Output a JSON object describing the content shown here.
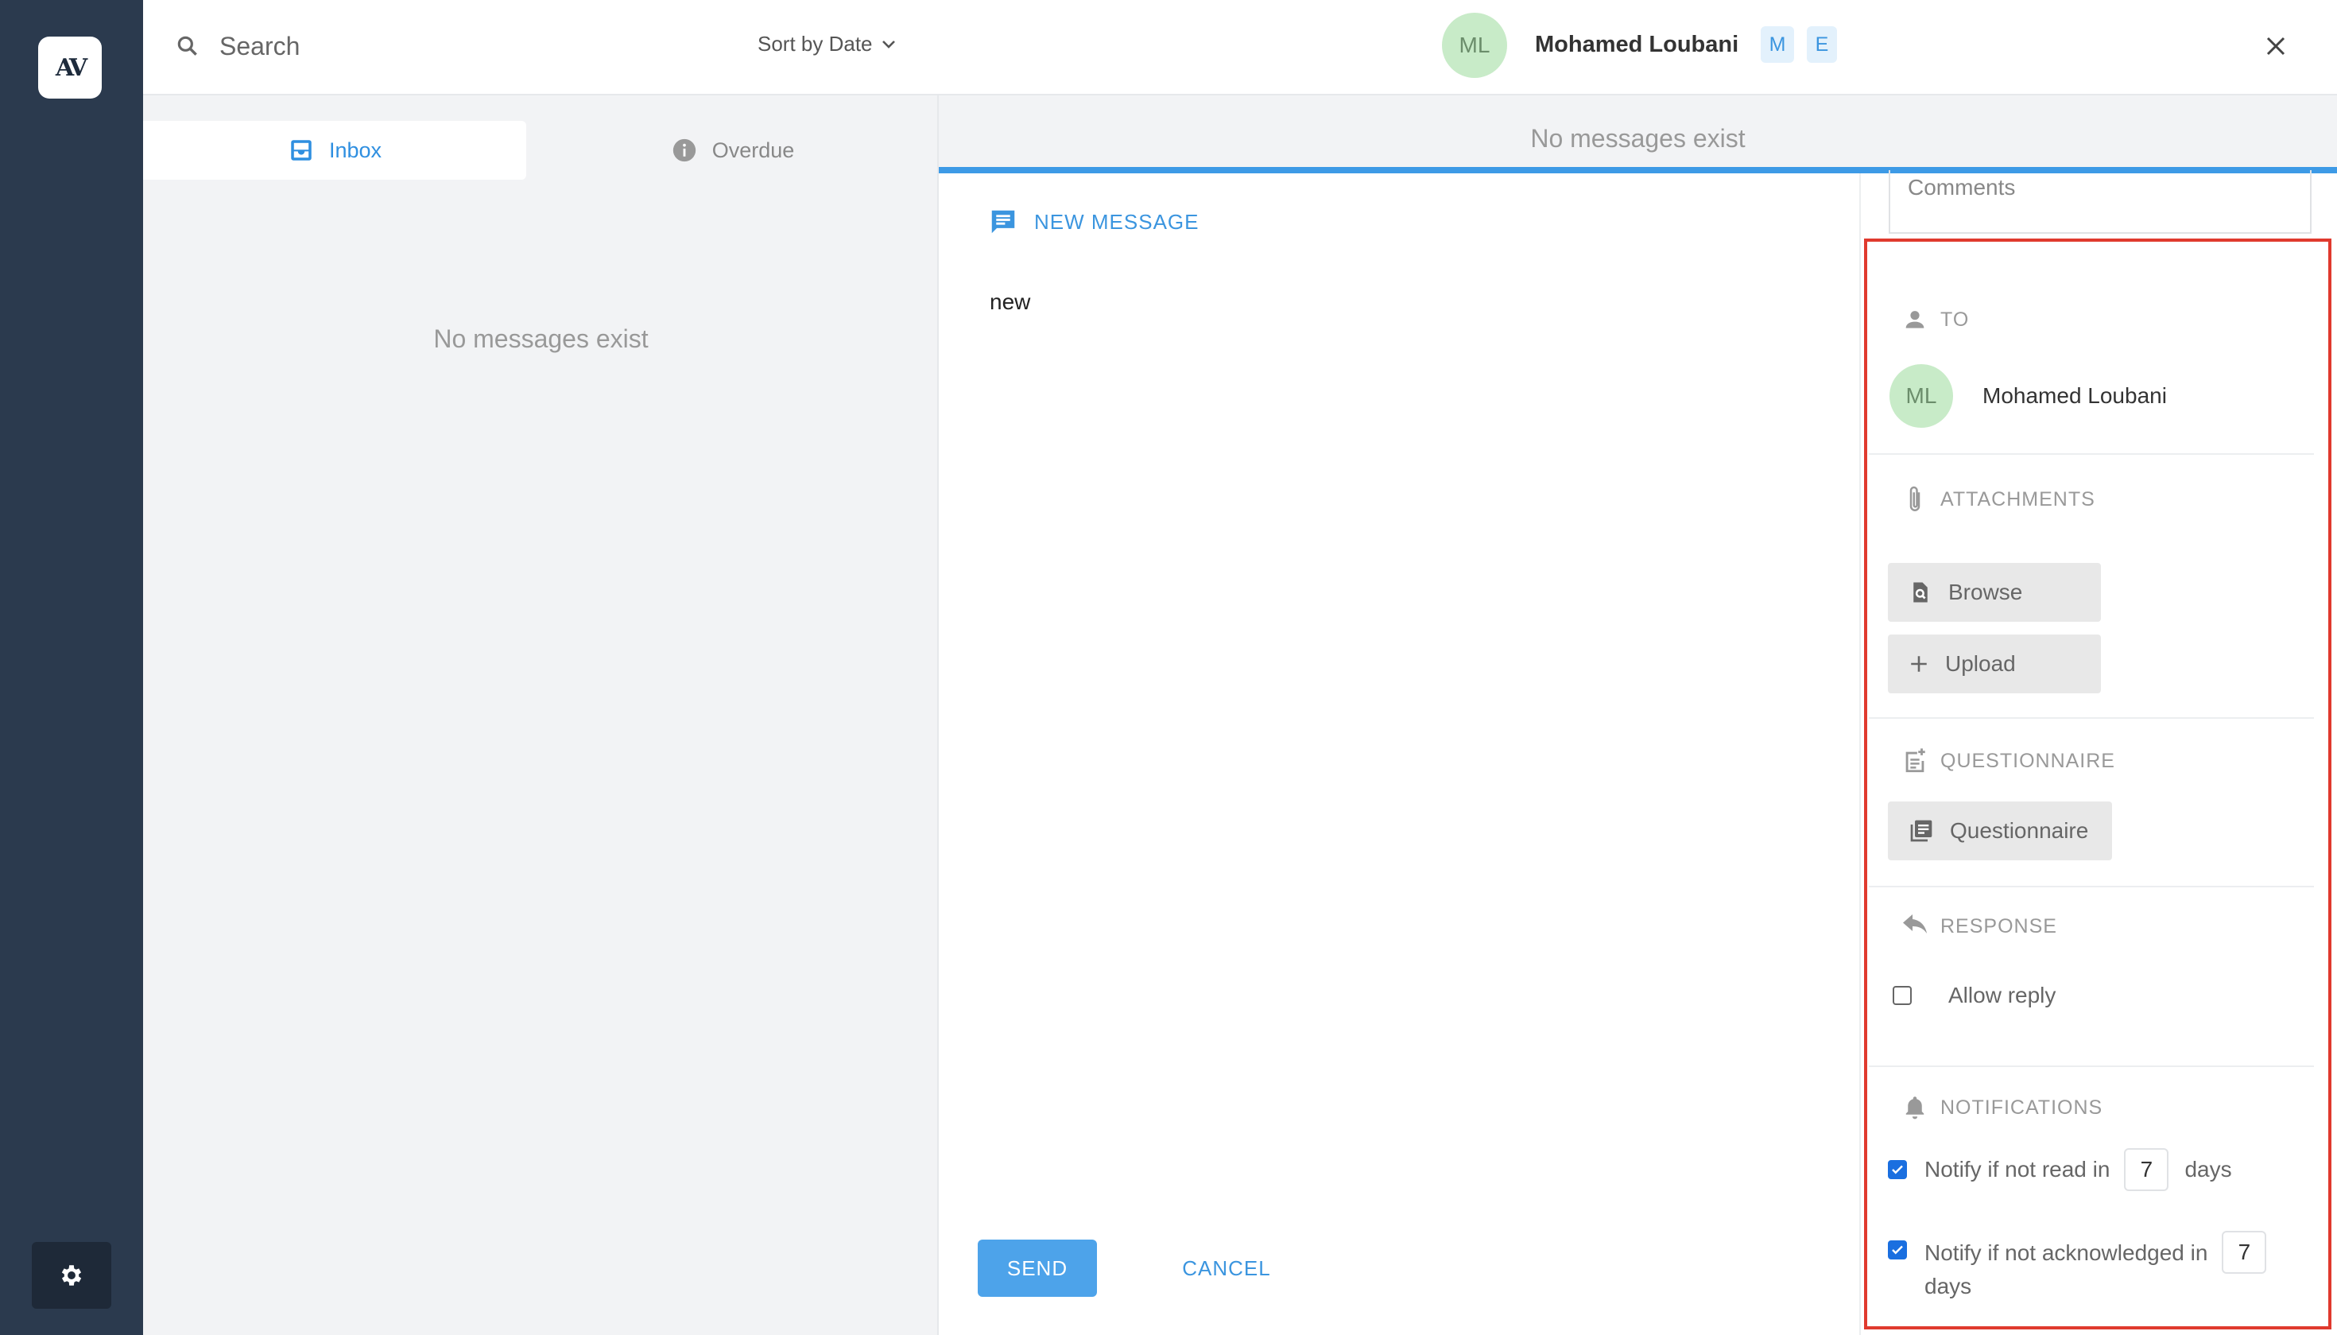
{
  "nav": {
    "logo_text": "AV",
    "settings_icon": "gear-icon"
  },
  "list": {
    "search_placeholder": "Search",
    "sort_label": "Sort by Date",
    "tabs": [
      {
        "label": "Inbox",
        "icon": "inbox-icon",
        "active": true
      },
      {
        "label": "Overdue",
        "icon": "info-icon",
        "active": false
      }
    ],
    "empty_text": "No messages exist"
  },
  "header": {
    "avatar_initials": "ML",
    "name": "Mohamed Loubani",
    "chips": [
      "M",
      "E"
    ]
  },
  "thread": {
    "empty_text": "No messages exist"
  },
  "composer": {
    "title": "NEW MESSAGE",
    "body": "new",
    "send_label": "SEND",
    "cancel_label": "CANCEL"
  },
  "side": {
    "comments_placeholder": "Comments",
    "to": {
      "heading": "TO",
      "avatar_initials": "ML",
      "name": "Mohamed Loubani"
    },
    "attachments": {
      "heading": "ATTACHMENTS",
      "browse_label": "Browse",
      "upload_label": "Upload"
    },
    "questionnaire": {
      "heading": "QUESTIONNAIRE",
      "button_label": "Questionnaire"
    },
    "response": {
      "heading": "RESPONSE",
      "allow_reply_label": "Allow reply",
      "allow_reply_checked": false
    },
    "notifications": {
      "heading": "NOTIFICATIONS",
      "not_read_label": "Notify if not read in",
      "not_read_days": "7",
      "not_read_suffix": "days",
      "not_read_checked": true,
      "not_ack_label": "Notify if not acknowledged in",
      "not_ack_days": "7",
      "not_ack_suffix": "days",
      "not_ack_checked": true
    }
  },
  "colors": {
    "accent": "#3b95df",
    "rail": "#2b3a4e",
    "highlight": "#e03a2e"
  }
}
